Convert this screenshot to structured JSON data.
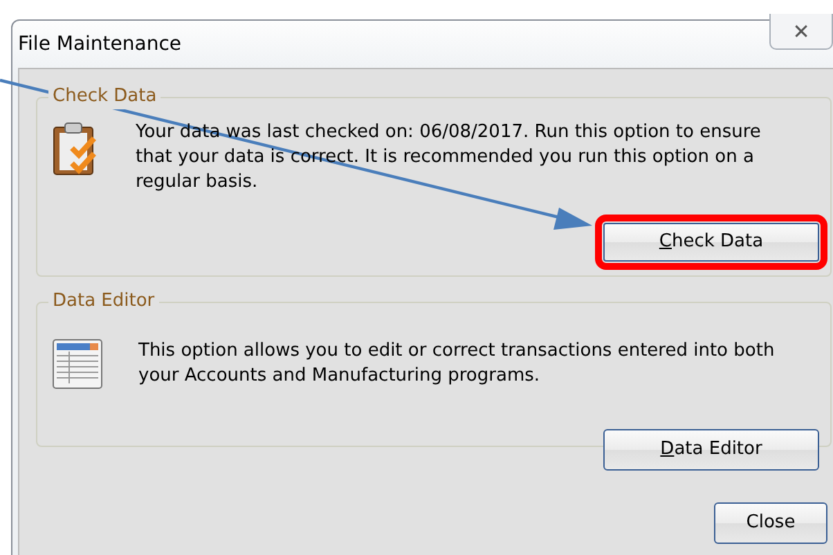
{
  "window": {
    "title": "File Maintenance",
    "close_symbol": "✕"
  },
  "groups": [
    {
      "title": "Check Data",
      "text": "Your data was last checked on: 06/08/2017.  Run this option to ensure that your data is correct.  It is recommended you run this option on a regular basis.",
      "button": {
        "label": "Check Data",
        "mnemonic_first": true,
        "highlighted": true
      }
    },
    {
      "title": "Data Editor",
      "text": "This option allows you to edit or correct transactions entered into both your Accounts and Manufacturing programs.",
      "button": {
        "label": "Data Editor",
        "mnemonic_first": true,
        "highlighted": false
      }
    }
  ],
  "footer_button": {
    "label": "Close",
    "mnemonic_first": false
  },
  "annotation": {
    "arrow": true
  }
}
